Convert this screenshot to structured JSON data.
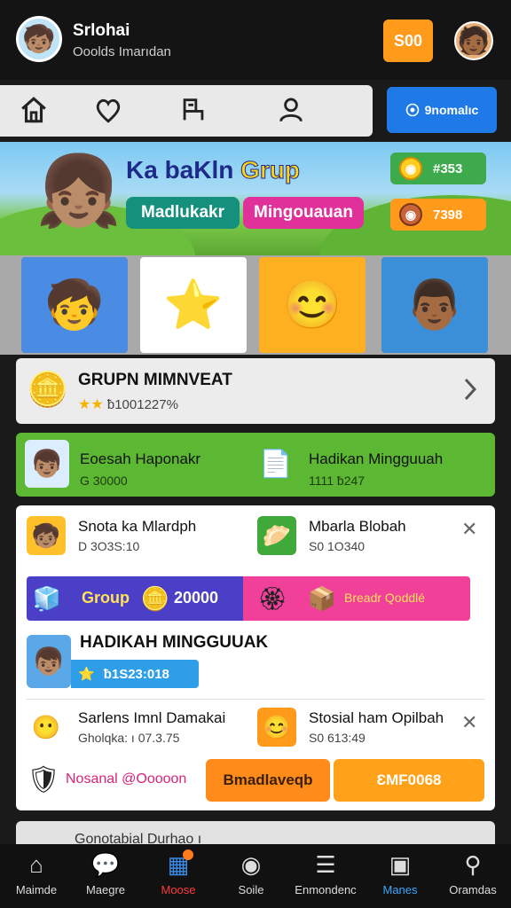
{
  "header": {
    "user_name": "Srlohai",
    "user_subtitle": "Ooolds Imarıdan",
    "coins_label": "S00",
    "avatar_emoji": "🧒🏽",
    "friend_emoji": "🧑🏾"
  },
  "nav": {
    "home_icon": "⌂",
    "favorites_icon": "♡",
    "chat_icon": "⎘",
    "profile_icon": "◯",
    "premium_label": "9nomalıc"
  },
  "banner": {
    "title_part1": "Ka baKln",
    "title_part2": "Grup",
    "pill_teal": "Madlukakr",
    "pill_pink": "Mingouauan",
    "stat_green": "#353",
    "stat_orange": "7398",
    "kid_emoji": "👧🏽"
  },
  "tiles": [
    {
      "emoji": "🧒"
    },
    {
      "emoji": "⭐"
    },
    {
      "emoji": "😊"
    },
    {
      "emoji": "👨🏾"
    }
  ],
  "group_card": {
    "title": "GRUPN MIMNVEAT",
    "stars": "★★",
    "subtitle": "ƀ1001227%",
    "icon": "🪙"
  },
  "green_card": {
    "item1_title": "Eoesah Haponakr",
    "item1_sub": "G 30000",
    "item1_icon": "👦🏽",
    "item2_title": "Hadikan Mingguuah",
    "item2_sub": "1111 ƀ247",
    "item2_icon": "📄"
  },
  "panel": {
    "row1": {
      "a_title": "Snota ka Mlardph",
      "a_sub": "D 3O3S:10",
      "a_icon": "🧒🏽",
      "b_title": "Mbarla Blobah",
      "b_sub": "S0 1O340",
      "b_icon": "🥟",
      "close": "✕"
    },
    "strip": {
      "group_label": "Group",
      "group_value": "20000",
      "right_label": "Breadr Qoddlé",
      "icon1": "🧊",
      "icon2": "🪙",
      "icon3": "🏵",
      "icon4": "📦"
    },
    "hadikah": {
      "title": "HADIKAH MINGGUUAK",
      "bar_value": "ƀ1S23:018",
      "face": "👦🏽",
      "star": "⭐"
    },
    "row2": {
      "a_title": "Sarlens Imnl Damakai",
      "a_sub": "Gholqka: ı 07.3.75",
      "a_icon": "😶",
      "b_title": "Stosial ham Opilbah",
      "b_sub": "S0 613:49",
      "b_icon": "😊",
      "close": "✕"
    },
    "actions": {
      "left_label": "Nosanal @Ooooon",
      "left_icon": "🛡",
      "btn1": "Bmadlaveqb",
      "btn2": "ƐMF0068"
    }
  },
  "peek": {
    "text": "Gonotabial Durhao ı"
  },
  "tabbar": [
    {
      "label": "Maimde",
      "icon": "⌂"
    },
    {
      "label": "Maegre",
      "icon": "💬"
    },
    {
      "label": "Moose",
      "icon": "▦"
    },
    {
      "label": "Soile",
      "icon": "◉"
    },
    {
      "label": "Enmondenc",
      "icon": "☰"
    },
    {
      "label": "Manes",
      "icon": "▣"
    },
    {
      "label": "Oramdas",
      "icon": "⚲"
    }
  ],
  "colors": {
    "accent_orange": "#ff9a1a",
    "premium_blue": "#1f7ae8",
    "green_card": "#5cb832",
    "tab_active_red": "#ff3b3b",
    "tab_active_blue": "#3aa8ff"
  }
}
